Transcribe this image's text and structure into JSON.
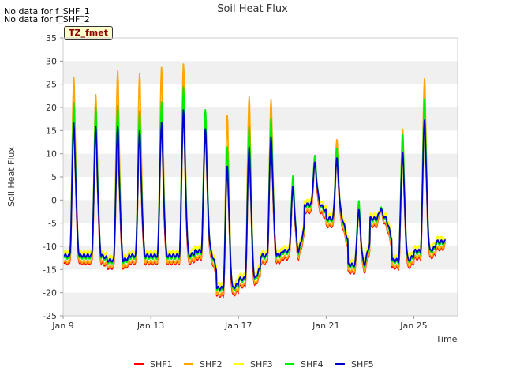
{
  "notes": [
    "No data for f_SHF_1",
    "No data for f_SHF_2"
  ],
  "tz_label": "TZ_fmet",
  "colors": {
    "SHF1": "#ff0000",
    "SHF2": "#ffa500",
    "SHF3": "#ffff00",
    "SHF4": "#00ee00",
    "SHF5": "#0000cc",
    "band": "#f0f0f0"
  },
  "chart_data": {
    "type": "line",
    "title": "Soil Heat Flux",
    "xlabel": "Time",
    "ylabel": "Soil Heat Flux",
    "ylim": [
      -25,
      35
    ],
    "yticks": [
      -25,
      -20,
      -15,
      -10,
      -5,
      0,
      5,
      10,
      15,
      20,
      25,
      30,
      35
    ],
    "xlim": [
      0,
      18
    ],
    "xticks": [
      {
        "day": 0,
        "label": "Jan 9"
      },
      {
        "day": 4,
        "label": "Jan 13"
      },
      {
        "day": 8,
        "label": "Jan 17"
      },
      {
        "day": 12,
        "label": "Jan 21"
      },
      {
        "day": 16,
        "label": "Jan 25"
      }
    ],
    "legend_position": "bottom",
    "grid": "alternating horizontal bands",
    "series_names": [
      "SHF1",
      "SHF2",
      "SHF3",
      "SHF4",
      "SHF5"
    ],
    "days": [
      {
        "min": -13,
        "peak": 17,
        "shf2_peak": 27
      },
      {
        "min": -13,
        "peak": 16,
        "shf2_peak": 23
      },
      {
        "min": -14,
        "peak": 16,
        "shf2_peak": 28
      },
      {
        "min": -13,
        "peak": 15,
        "shf2_peak": 27.5
      },
      {
        "min": -13,
        "peak": 17,
        "shf2_peak": 29
      },
      {
        "min": -13,
        "peak": 20,
        "shf2_peak": 30
      },
      {
        "min": -12,
        "peak": 16,
        "shf2_peak": 18
      },
      {
        "min": -20,
        "peak": 8,
        "shf2_peak": 19
      },
      {
        "min": -18,
        "peak": 12,
        "shf2_peak": 23
      },
      {
        "min": -13,
        "peak": 14,
        "shf2_peak": 22
      },
      {
        "min": -12,
        "peak": 3,
        "shf2_peak": 3
      },
      {
        "min": -2,
        "peak": 8,
        "shf2_peak": 9
      },
      {
        "min": -5,
        "peak": 9,
        "shf2_peak": 13
      },
      {
        "min": -15,
        "peak": -2,
        "shf2_peak": -2
      },
      {
        "min": -5,
        "peak": -2,
        "shf2_peak": -2
      },
      {
        "min": -14,
        "peak": 11,
        "shf2_peak": 16
      },
      {
        "min": -12,
        "peak": 18,
        "shf2_peak": 27
      },
      {
        "min": -10,
        "peak": -9,
        "shf2_peak": -9
      }
    ]
  }
}
